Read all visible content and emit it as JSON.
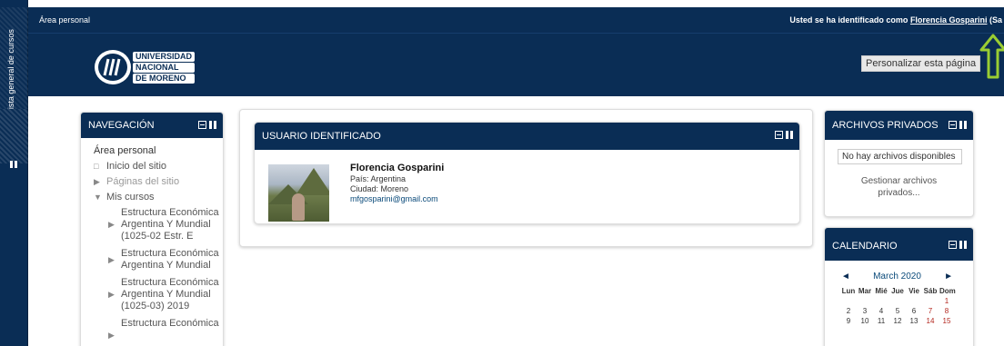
{
  "dock": {
    "label": "Vista general de cursos"
  },
  "topbar": {
    "breadcrumb": "Área personal",
    "login_prefix": "Usted se ha identificado como",
    "user_name": "Florencia Gosparini",
    "login_suffix": "(Sa"
  },
  "header": {
    "logo_lines": [
      "UNIVERSIDAD",
      "NACIONAL",
      "DE MORENO"
    ],
    "customize_label": "Personalizar esta página"
  },
  "navigation": {
    "title": "NAVEGACIÓN",
    "home": "Área personal",
    "items": [
      {
        "label": "Inicio del sitio"
      },
      {
        "label": "Páginas del sitio"
      },
      {
        "label": "Mis cursos"
      }
    ],
    "courses": [
      {
        "label": "Estructura Económica Argentina Y Mundial (1025-02 Estr. E"
      },
      {
        "label": "Estructura Económica Argentina Y Mundial"
      },
      {
        "label": "Estructura Económica Argentina Y Mundial (1025-03) 2019"
      },
      {
        "label": "Estructura Económica"
      }
    ]
  },
  "user_block": {
    "title": "USUARIO IDENTIFICADO",
    "name": "Florencia Gosparini",
    "country": "País: Argentina",
    "city": "Ciudad: Moreno",
    "email": "mfgosparini@gmail.com"
  },
  "files_block": {
    "title": "ARCHIVOS PRIVADOS",
    "empty": "No hay archivos disponibles",
    "manage": "Gestionar archivos privados..."
  },
  "calendar": {
    "title": "CALENDARIO",
    "prev": "◄",
    "next": "►",
    "month": "March 2020",
    "weekdays": [
      "Lun",
      "Mar",
      "Mié",
      "Jue",
      "Vie",
      "Sáb",
      "Dom"
    ],
    "rows": [
      [
        "",
        "",
        "",
        "",
        "",
        "",
        "1"
      ],
      [
        "2",
        "3",
        "4",
        "5",
        "6",
        "7",
        "8"
      ],
      [
        "9",
        "10",
        "11",
        "12",
        "13",
        "14",
        "15"
      ]
    ]
  },
  "colors": {
    "brand": "#0a2d55",
    "arrow": "#9acd32",
    "weekend": "#b3261e"
  }
}
